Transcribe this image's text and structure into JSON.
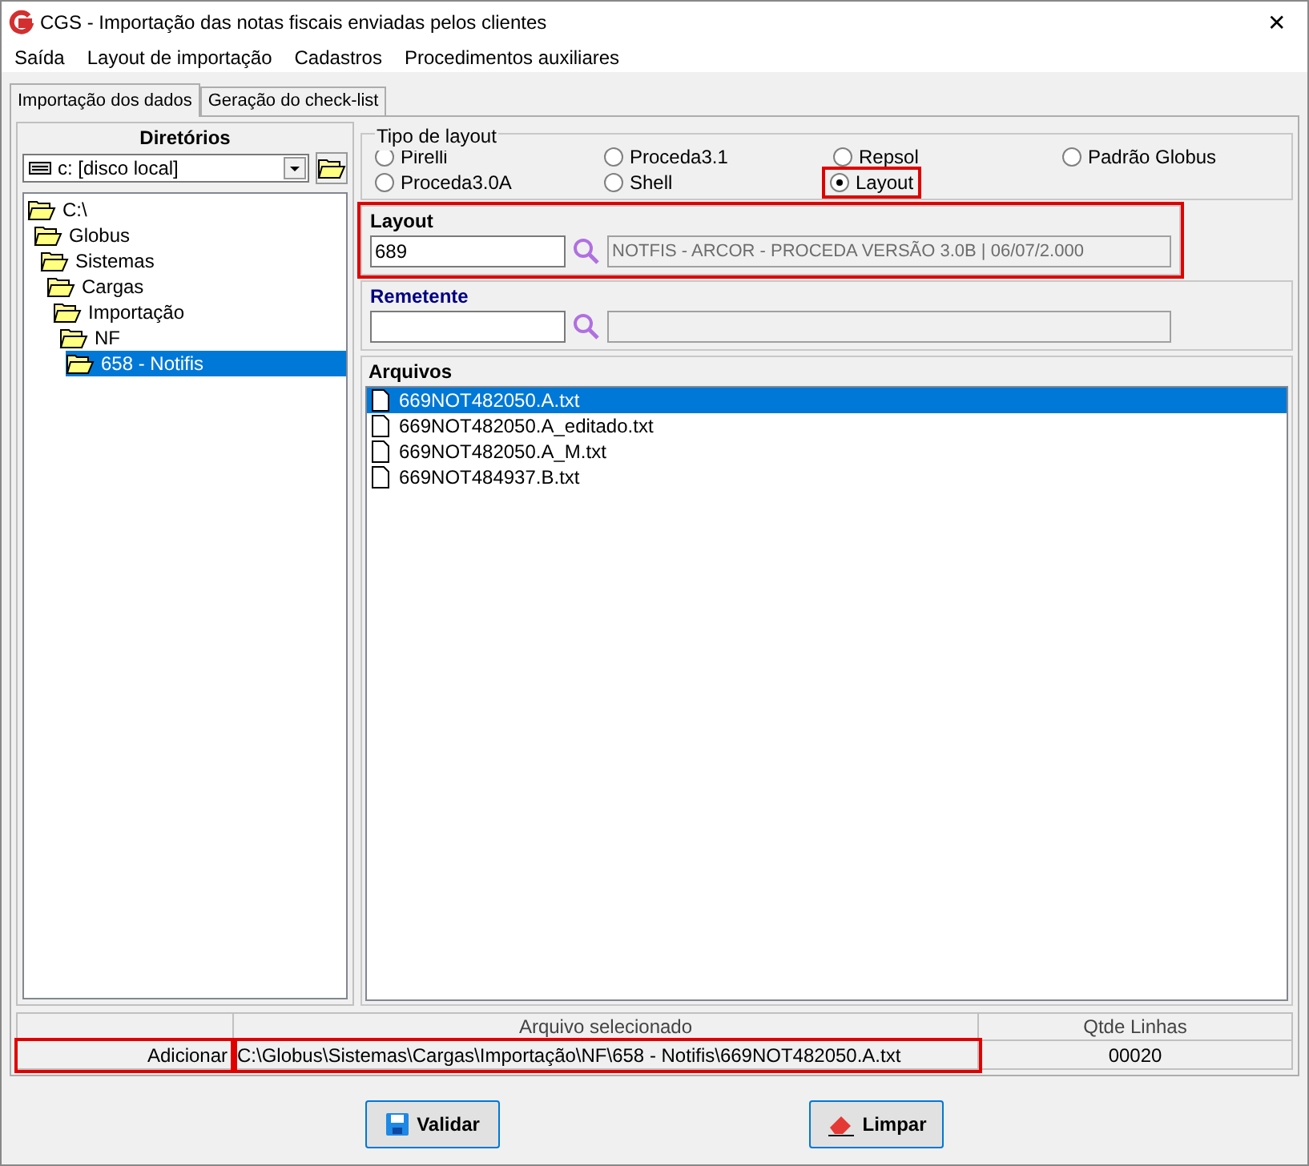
{
  "window": {
    "title": "CGS - Importação das notas fiscais enviadas pelos clientes",
    "close": "✕"
  },
  "menu": [
    "Saída",
    "Layout de importação",
    "Cadastros",
    "Procedimentos auxiliares"
  ],
  "tabs": [
    {
      "label": "Importação dos dados",
      "selected": true
    },
    {
      "label": "Geração do check-list",
      "selected": false
    }
  ],
  "directories": {
    "title": "Diretórios",
    "drive": "c: [disco local]",
    "tree": [
      {
        "label": "C:\\",
        "selected": false,
        "children": [
          {
            "label": "Globus",
            "selected": false,
            "children": [
              {
                "label": "Sistemas",
                "selected": false,
                "children": [
                  {
                    "label": "Cargas",
                    "selected": false,
                    "children": [
                      {
                        "label": "Importação",
                        "selected": false,
                        "children": [
                          {
                            "label": "NF",
                            "selected": false,
                            "children": [
                              {
                                "label": "658 - Notifis",
                                "selected": true
                              }
                            ]
                          }
                        ]
                      }
                    ]
                  }
                ]
              }
            ]
          }
        ]
      }
    ]
  },
  "layout_type": {
    "title": "Tipo de layout",
    "options": [
      {
        "label": "Pirelli",
        "selected": false
      },
      {
        "label": "Proceda3.1",
        "selected": false
      },
      {
        "label": "Repsol",
        "selected": false
      },
      {
        "label": "Padrão Globus",
        "selected": false
      },
      {
        "label": "Proceda3.0A",
        "selected": false
      },
      {
        "label": "Shell",
        "selected": false
      },
      {
        "label": "Layout",
        "selected": true
      }
    ]
  },
  "layout": {
    "title": "Layout",
    "code": "689",
    "description": "NOTFIS - ARCOR - PROCEDA VERSÃO 3.0B | 06/07/2.000"
  },
  "sender": {
    "title": "Remetente"
  },
  "files": {
    "title": "Arquivos",
    "items": [
      {
        "name": "669NOT482050.A.txt",
        "selected": true
      },
      {
        "name": "669NOT482050.A_editado.txt",
        "selected": false
      },
      {
        "name": "669NOT482050.A_M.txt",
        "selected": false
      },
      {
        "name": "669NOT484937.B.txt",
        "selected": false
      }
    ]
  },
  "summary": {
    "columns": [
      "Arquivo selecionado",
      "Qtde Linhas"
    ],
    "action": "Adicionar",
    "path": "C:\\Globus\\Sistemas\\Cargas\\Importação\\NF\\658 - Notifis\\669NOT482050.A.txt",
    "lines": "00020"
  },
  "buttons": [
    {
      "kind": "save",
      "label": "Validar"
    },
    {
      "kind": "erase",
      "label": "Limpar"
    }
  ]
}
